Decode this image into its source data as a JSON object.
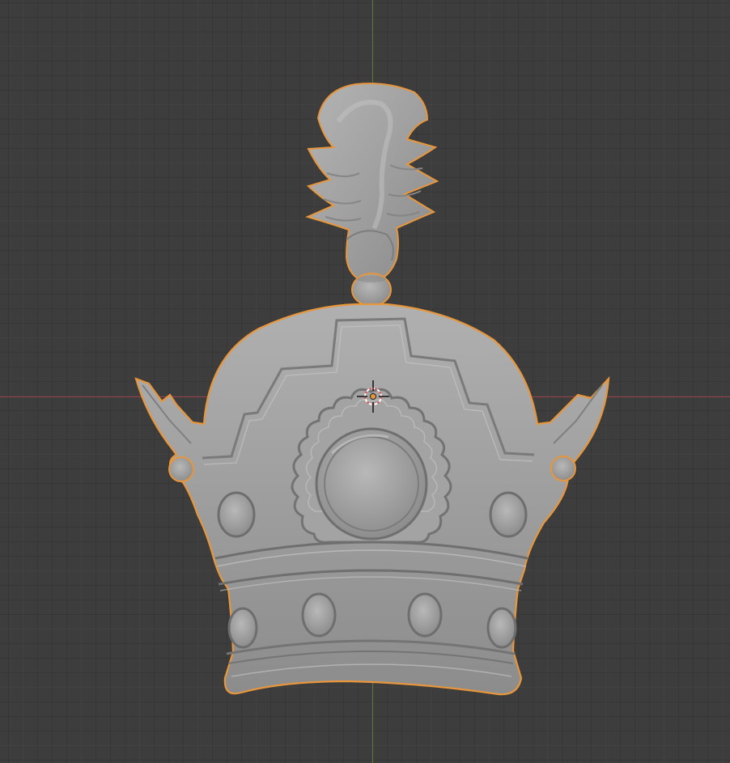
{
  "viewport": {
    "mode": "3D Viewport",
    "selected_object": "crown-mesh",
    "colors": {
      "background": "#3d3d3d",
      "grid_line": "#4a4a4a",
      "x_axis": "#9a3e47",
      "y_axis": "#5e7d2c",
      "selection_outline": "#e8963b",
      "mesh_fill": "#9f9f9f"
    }
  }
}
